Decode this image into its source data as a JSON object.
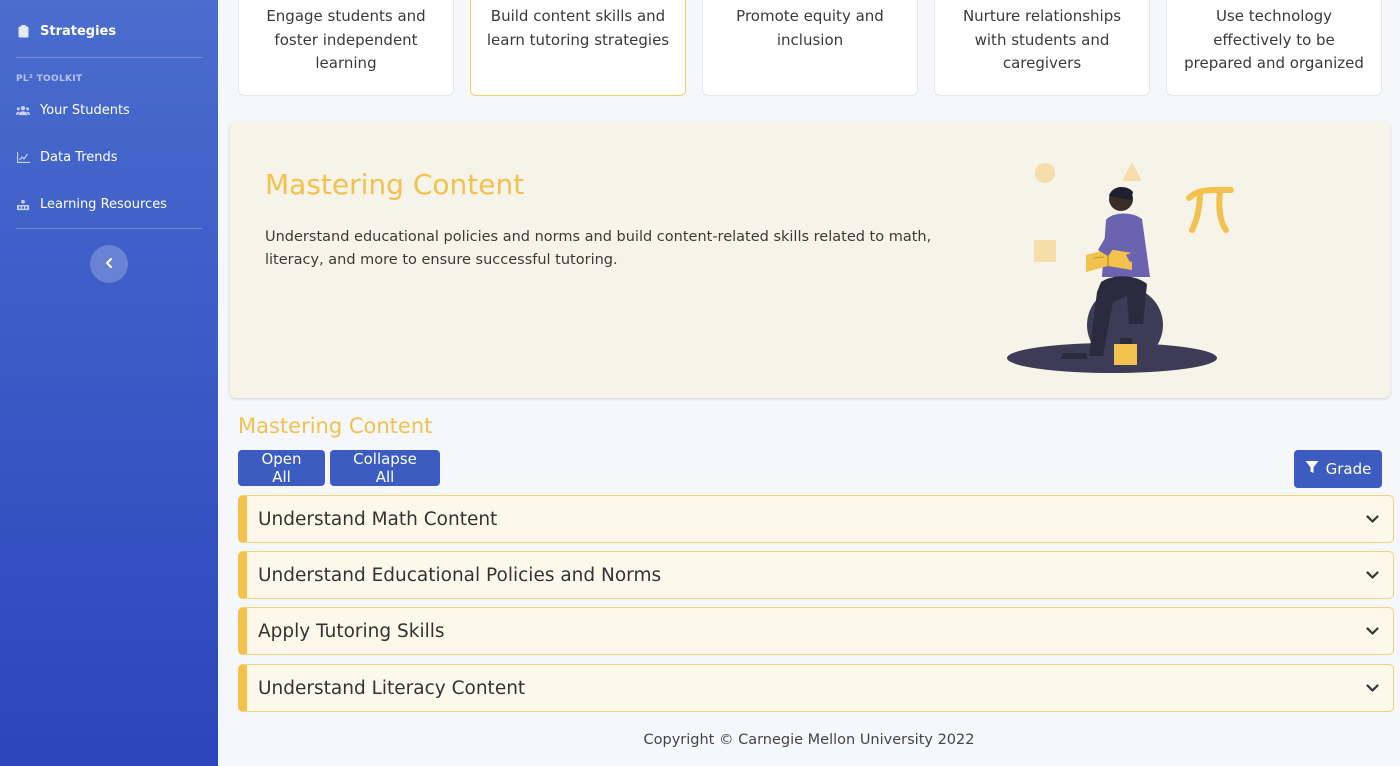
{
  "sidebar": {
    "active_item": {
      "label": "Strategies",
      "icon": "clipboard-icon"
    },
    "section_label": "PL² TOOLKIT",
    "items": [
      {
        "label": "Your Students",
        "icon": "users-icon"
      },
      {
        "label": "Data Trends",
        "icon": "chart-icon"
      },
      {
        "label": "Learning Resources",
        "icon": "resources-icon"
      }
    ],
    "collapse_icon": "chevron-left-icon"
  },
  "cards": [
    {
      "label": "Engage students and foster independent learning"
    },
    {
      "label": "Build content skills and learn tutoring strategies",
      "active": true
    },
    {
      "label": "Promote equity and inclusion"
    },
    {
      "label": "Nurture relationships with students and caregivers"
    },
    {
      "label": "Use technology effectively to be prepared and organized"
    }
  ],
  "hero": {
    "title": "Mastering Content",
    "description": "Understand educational policies and norms and build content-related skills related to math, literacy, and more to ensure successful tutoring.",
    "illustration": "person-reading-with-pi-symbol"
  },
  "section": {
    "title": "Mastering Content",
    "open_all_label": "Open All",
    "collapse_all_label": "Collapse All",
    "grade_label": "Grade",
    "grade_icon": "filter-icon"
  },
  "accordion": [
    {
      "label": "Understand Math Content"
    },
    {
      "label": "Understand Educational Policies and Norms"
    },
    {
      "label": "Apply Tutoring Skills"
    },
    {
      "label": "Understand Literacy Content"
    }
  ],
  "footer": {
    "text": "Copyright © Carnegie Mellon University 2022"
  },
  "colors": {
    "sidebar_top": "#4a6dce",
    "sidebar_bottom": "#2d45bb",
    "accent_yellow": "#f2c14e",
    "button_blue": "#3d5cc2",
    "hero_bg": "#f6f3e8",
    "accordion_bg": "#fdf8e9"
  }
}
